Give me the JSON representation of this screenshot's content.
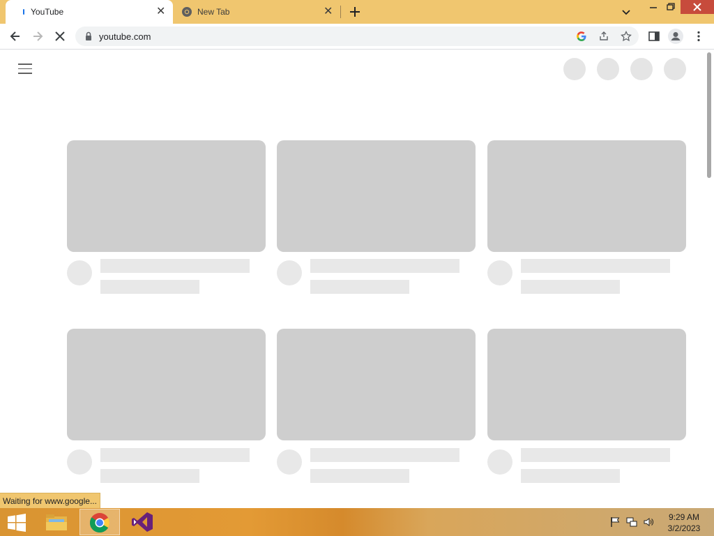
{
  "browser": {
    "tabs": [
      {
        "title": "YouTube",
        "active": true,
        "loading": true
      },
      {
        "title": "New Tab",
        "active": false
      }
    ],
    "url": "youtube.com",
    "accent_color": "#f0c66f",
    "status_text": "Waiting for www.google..."
  },
  "youtube": {
    "skeleton_rows": 2,
    "skeleton_columns": 3,
    "header_placeholder_count": 4
  },
  "taskbar": {
    "apps": [
      {
        "name": "file-explorer-icon",
        "active": false
      },
      {
        "name": "chrome-icon",
        "active": true
      },
      {
        "name": "visual-studio-icon",
        "active": false
      }
    ],
    "clock": {
      "time": "9:29 AM",
      "date": "3/2/2023"
    }
  }
}
